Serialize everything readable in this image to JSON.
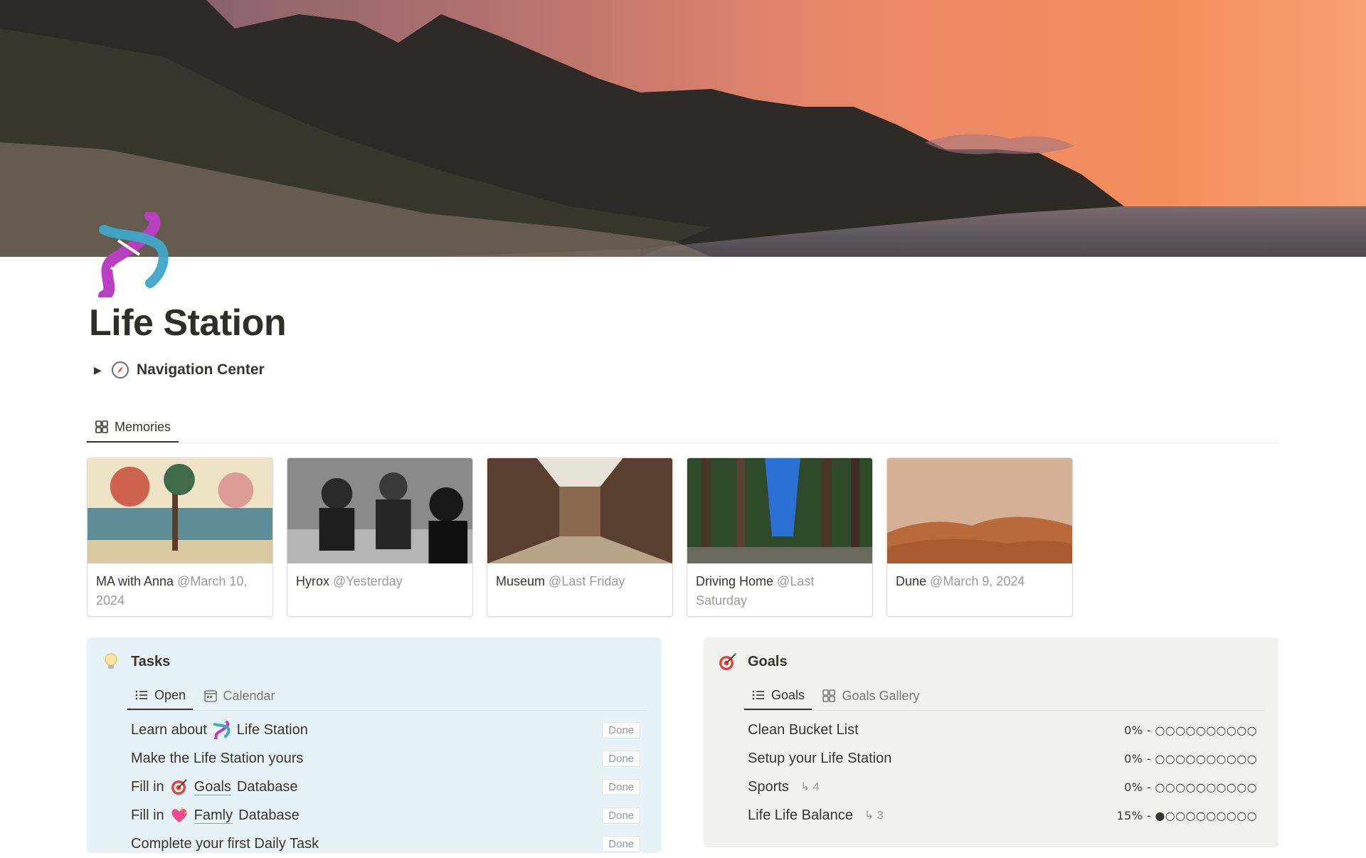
{
  "page": {
    "title": "Life Station",
    "toggle_label": "Navigation Center"
  },
  "memories": {
    "tab_label": "Memories",
    "cards": [
      {
        "name": "MA with Anna",
        "date": "@March 10, 2024"
      },
      {
        "name": "Hyrox",
        "date": "@Yesterday"
      },
      {
        "name": "Museum",
        "date": "@Last Friday"
      },
      {
        "name": "Driving Home",
        "date": "@Last Saturday"
      },
      {
        "name": "Dune",
        "date": "@March 9, 2024"
      }
    ]
  },
  "tasks": {
    "title": "Tasks",
    "tabs": [
      "Open",
      "Calendar"
    ],
    "done_label": "Done",
    "rows": [
      {
        "prefix": "Learn about",
        "link": "Life Station",
        "suffix": ""
      },
      {
        "prefix": "Make the Life Station yours",
        "link": "",
        "suffix": ""
      },
      {
        "prefix": "Fill in",
        "link": "Goals",
        "suffix": "Database"
      },
      {
        "prefix": "Fill in",
        "link": "Famly",
        "suffix": "Database"
      },
      {
        "prefix": "Complete your first Daily Task",
        "link": "",
        "suffix": ""
      }
    ]
  },
  "goals": {
    "title": "Goals",
    "tabs": [
      "Goals",
      "Goals Gallery"
    ],
    "rows": [
      {
        "name": "Clean Bucket List",
        "sub": "",
        "progress": "0% - ○○○○○○○○○○"
      },
      {
        "name": "Setup your Life Station",
        "sub": "",
        "progress": "0% - ○○○○○○○○○○"
      },
      {
        "name": "Sports",
        "sub": "↳ 4",
        "progress": "0% - ○○○○○○○○○○"
      },
      {
        "name": "Life Life Balance",
        "sub": "↳ 3",
        "progress": "15% - ●○○○○○○○○○"
      }
    ]
  },
  "colors": {
    "tasks_bg": "#e7f2f8",
    "goals_bg": "#f1f1ef",
    "text": "#37352f",
    "muted": "#9b9a97"
  },
  "icons": [
    "dna-icon",
    "compass-icon",
    "gallery-icon",
    "lightbulb-icon",
    "list-icon",
    "calendar-icon",
    "target-icon",
    "heart-icon"
  ]
}
